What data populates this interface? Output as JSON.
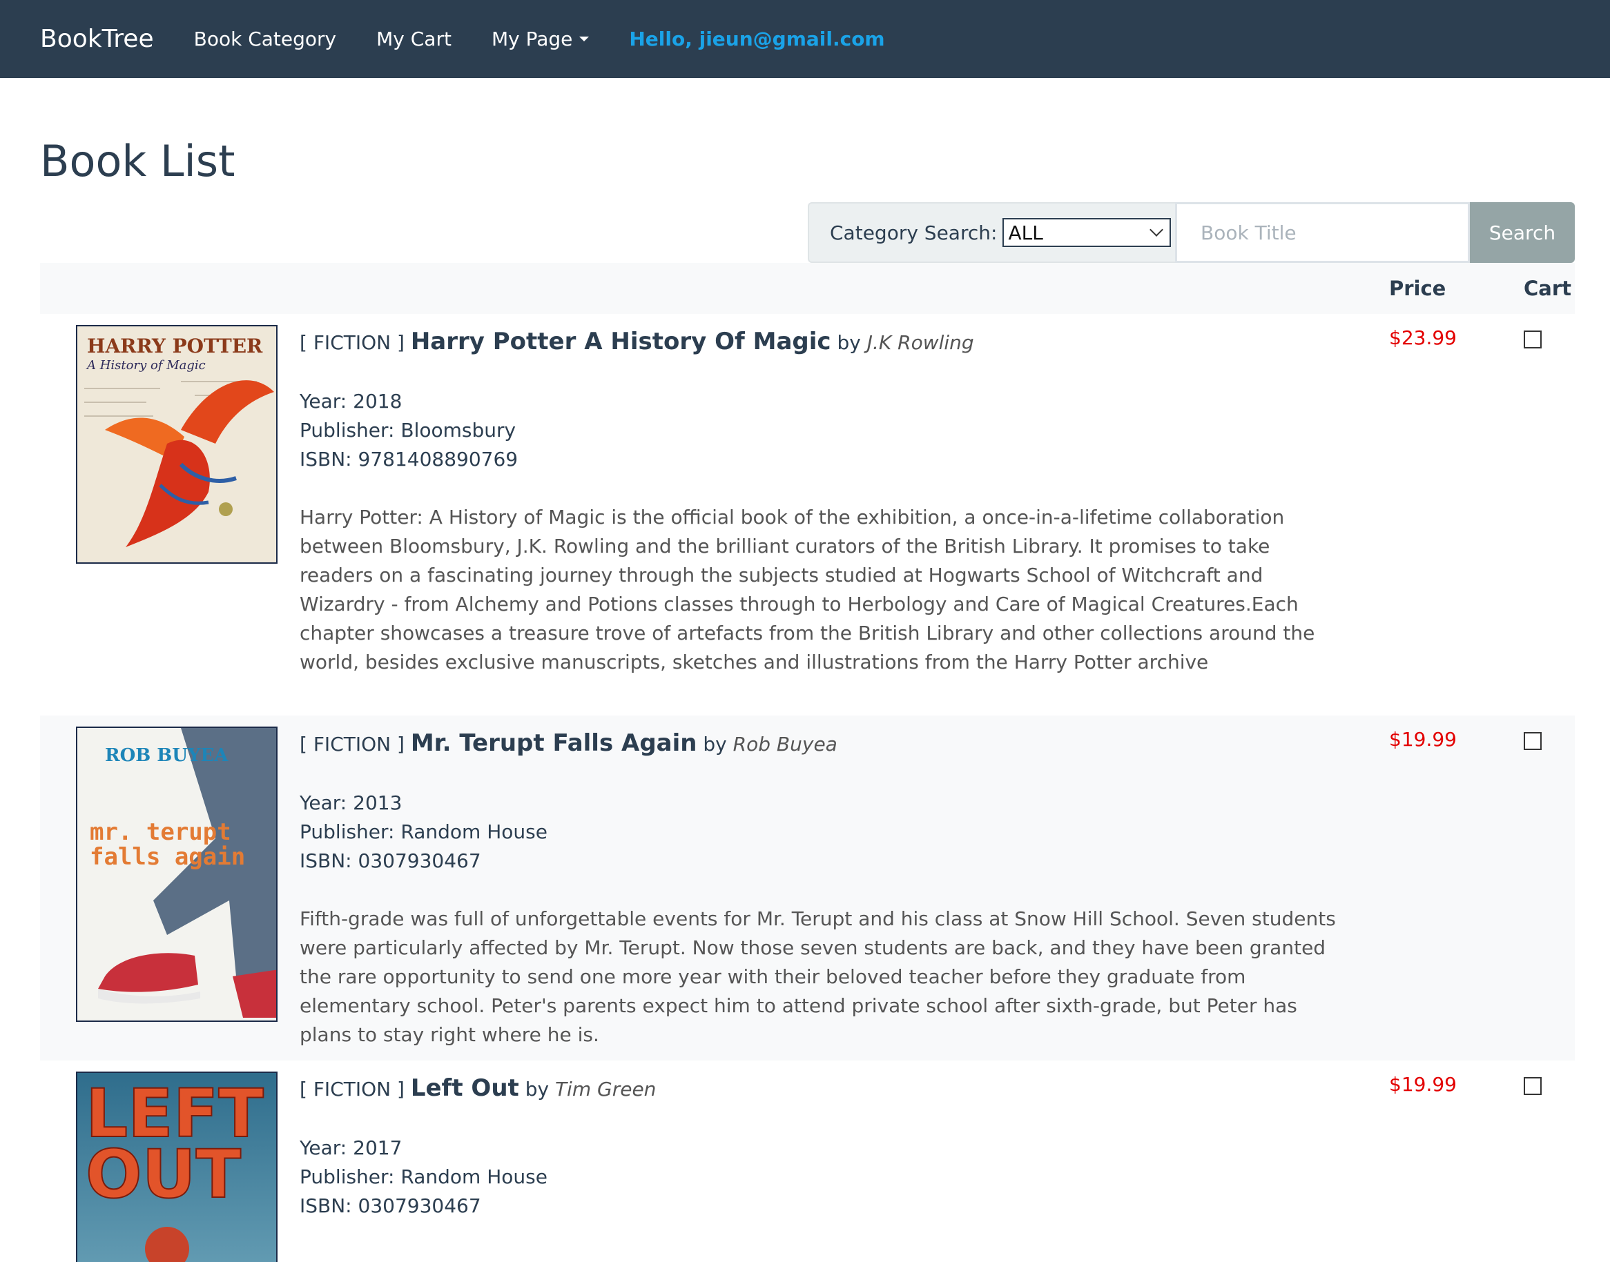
{
  "nav": {
    "brand": "BookTree",
    "links": [
      "Book Category",
      "My Cart",
      "My Page"
    ],
    "greeting": "Hello, jieun@gmail.com"
  },
  "page_title": "Book List",
  "search": {
    "label": "Category Search:",
    "selected": "ALL",
    "placeholder": "Book Title",
    "button": "Search"
  },
  "table_head": {
    "price": "Price",
    "cart": "Cart"
  },
  "books": [
    {
      "category": "[ FICTION ]",
      "title": "Harry Potter A History Of Magic",
      "by": "by",
      "author": "J.K Rowling",
      "year": "Year: 2018",
      "publisher": "Publisher: Bloomsbury",
      "isbn": "ISBN: 9781408890769",
      "description": "Harry Potter: A History of Magic is the official book of the exhibition, a once-in-a-lifetime collaboration between Bloomsbury, J.K. Rowling and the brilliant curators of the British Library. It promises to take readers on a fascinating journey through the subjects studied at Hogwarts School of Witchcraft and Wizardry - from Alchemy and Potions classes through to Herbology and Care of Magical Creatures.Each chapter showcases a treasure trove of artefacts from the British Library and other collections around the world, besides exclusive manuscripts, sketches and illustrations from the Harry Potter archive",
      "price": "$23.99",
      "cover_text": [
        "HARRY POTTER",
        "A History of Magic"
      ]
    },
    {
      "category": "[ FICTION ]",
      "title": "Mr. Terupt Falls Again",
      "by": "by",
      "author": "Rob Buyea",
      "year": "Year: 2013",
      "publisher": "Publisher: Random House",
      "isbn": "ISBN: 0307930467",
      "description": "Fifth-grade was full of unforgettable events for Mr. Terupt and his class at Snow Hill School. Seven students were particularly affected by Mr. Terupt. Now those seven students are back, and they have been granted the rare opportunity to send one more year with their beloved teacher before they graduate from elementary school. Peter's parents expect him to attend private school after sixth-grade, but Peter has plans to stay right where he is.",
      "price": "$19.99",
      "cover_text": [
        "ROB BUYEA",
        "mr. terupt",
        "falls again"
      ]
    },
    {
      "category": "[ FICTION ]",
      "title": "Left Out",
      "by": "by",
      "author": "Tim Green",
      "year": "Year: 2017",
      "publisher": "Publisher: Random House",
      "isbn": "ISBN: 0307930467",
      "description": "",
      "price": "$19.99",
      "cover_text": [
        "LEFT",
        "OUT"
      ]
    }
  ]
}
